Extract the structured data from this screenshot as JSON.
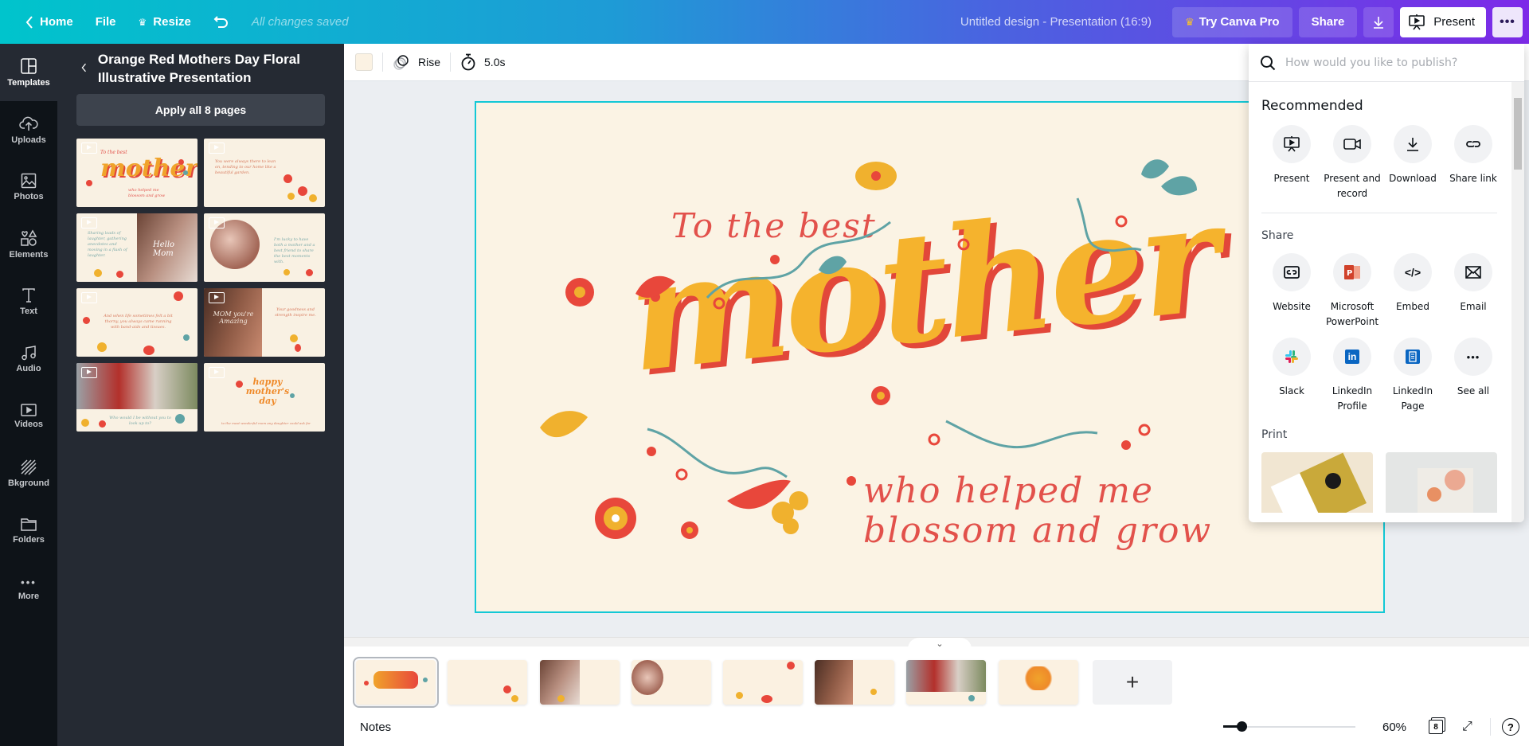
{
  "topbar": {
    "home_label": "Home",
    "file_label": "File",
    "resize_label": "Resize",
    "save_status": "All changes saved",
    "design_title": "Untitled design - Presentation (16:9)",
    "try_pro_label": "Try Canva Pro",
    "share_label": "Share",
    "present_label": "Present",
    "crown_color": "#f8c22a"
  },
  "rail": {
    "items": [
      {
        "label": "Templates",
        "icon": "templates-icon",
        "active": true
      },
      {
        "label": "Uploads",
        "icon": "upload-cloud-icon"
      },
      {
        "label": "Photos",
        "icon": "photo-icon"
      },
      {
        "label": "Elements",
        "icon": "shapes-icon"
      },
      {
        "label": "Text",
        "icon": "text-icon"
      },
      {
        "label": "Audio",
        "icon": "music-note-icon"
      },
      {
        "label": "Videos",
        "icon": "video-icon"
      },
      {
        "label": "Bkground",
        "icon": "background-hatch-icon"
      },
      {
        "label": "Folders",
        "icon": "folder-icon"
      },
      {
        "label": "More",
        "icon": "more-dots-icon"
      }
    ]
  },
  "panel": {
    "title": "Orange Red Mothers Day Floral Illustrative Presentation",
    "apply_label": "Apply all 8 pages",
    "templates": [
      {
        "label": "mother",
        "caption": "To the best / who helped me blossom and grow"
      },
      {
        "label": "",
        "caption": "You were always there to lean on..."
      },
      {
        "label": "Hello Mom",
        "caption": "Sharing loads of laughter..."
      },
      {
        "label": "",
        "caption": "I'm lucky to have both a mother and a best friend..."
      },
      {
        "label": "",
        "caption": "And when life sometimes felt a bit thorny..."
      },
      {
        "label": "MOM you're Amazing",
        "caption": "Your goodness and strength inspire me."
      },
      {
        "label": "",
        "caption": "Who would I be without you to look up to?"
      },
      {
        "label": "happy mother's day",
        "caption": "to the most wonderful mom any daughter could ask for"
      }
    ]
  },
  "toolbar2": {
    "bg_color": "#fbf2e3",
    "animation_label": "Rise",
    "duration_label": "5.0s"
  },
  "slide": {
    "line1": "To the best",
    "headline": "mother",
    "line2": "who helped me",
    "line3": "blossom and grow",
    "colors": {
      "background": "#fbf3e4",
      "script": "#e2514b",
      "gold": "#f5b32d",
      "red": "#e2473a",
      "teal": "#5fa3a5"
    }
  },
  "pages": {
    "count": "8",
    "selected": 1
  },
  "footer": {
    "notes_label": "Notes",
    "zoom_value": "60%",
    "zoom_fraction": 0.14,
    "page_count": "8"
  },
  "publish": {
    "search_placeholder": "How would you like to publish?",
    "recommended_heading": "Recommended",
    "recommended": [
      {
        "label": "Present",
        "icon": "present-icon"
      },
      {
        "label": "Present and record",
        "icon": "video-camera-icon"
      },
      {
        "label": "Download",
        "icon": "download-icon"
      },
      {
        "label": "Share link",
        "icon": "link-icon"
      }
    ],
    "share_heading": "Share",
    "share": [
      {
        "label": "Website",
        "icon": "website-icon"
      },
      {
        "label": "Microsoft PowerPoint",
        "icon": "powerpoint-icon"
      },
      {
        "label": "Embed",
        "icon": "embed-code-icon"
      },
      {
        "label": "Email",
        "icon": "email-icon"
      },
      {
        "label": "Slack",
        "icon": "slack-icon"
      },
      {
        "label": "LinkedIn Profile",
        "icon": "linkedin-icon"
      },
      {
        "label": "LinkedIn Page",
        "icon": "linkedin-page-icon"
      },
      {
        "label": "See all",
        "icon": "more-dots-icon"
      }
    ],
    "print_heading": "Print"
  }
}
